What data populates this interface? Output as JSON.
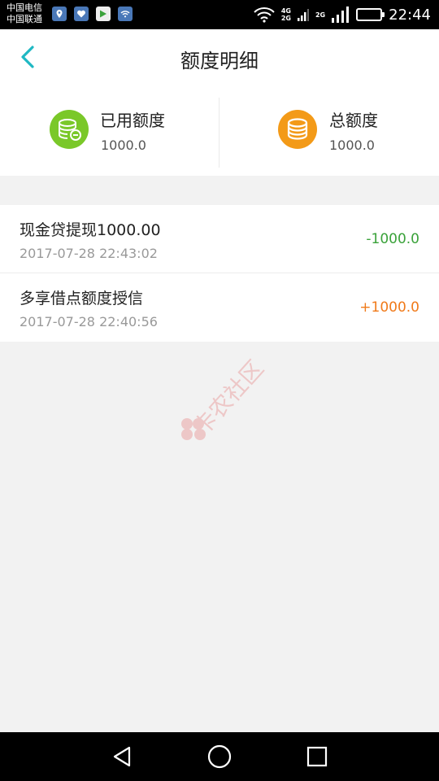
{
  "status_bar": {
    "carrier_1": "中国电信",
    "carrier_2": "中国联通",
    "net_tag_1": "4G",
    "net_tag_2": "2G",
    "net_tag_3": "2G",
    "time": "22:44",
    "notification_icons": [
      "location-icon",
      "heart-app-icon",
      "play-store-icon",
      "wifi-app-icon"
    ]
  },
  "header": {
    "title": "额度明细",
    "back_icon": "chevron-left-icon"
  },
  "summary": {
    "used": {
      "label": "已用额度",
      "value": "1000.0",
      "icon": "coins-minus-icon",
      "color": "#7ac829"
    },
    "total": {
      "label": "总额度",
      "value": "1000.0",
      "icon": "coins-icon",
      "color": "#f39a18"
    }
  },
  "records": [
    {
      "title": "现金贷提现1000.00",
      "time": "2017-07-28 22:43:02",
      "amount": "-1000.0",
      "direction": "negative"
    },
    {
      "title": "多享借点额度授信",
      "time": "2017-07-28 22:40:56",
      "amount": "+1000.0",
      "direction": "positive"
    }
  ],
  "watermark": {
    "text": "卡农社区"
  },
  "colors": {
    "accent": "#1fb8c3",
    "negative": "#3aa23a",
    "positive": "#f07a1a"
  },
  "nav_bar": {
    "back": "triangle-back-icon",
    "home": "circle-home-icon",
    "recents": "square-recents-icon"
  }
}
